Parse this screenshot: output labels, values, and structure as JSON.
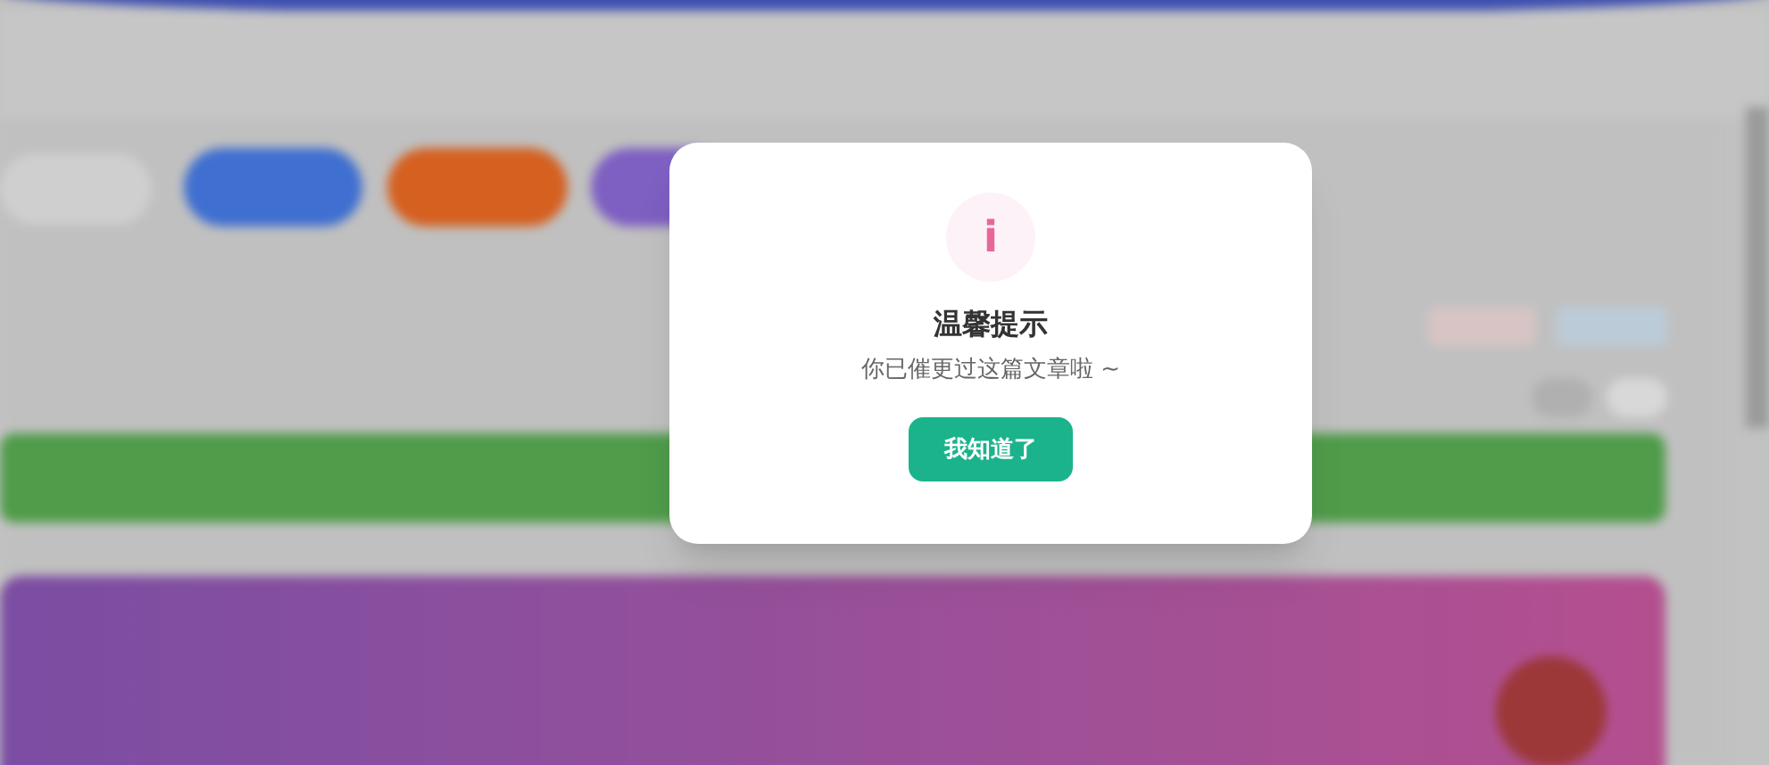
{
  "dialog": {
    "icon_glyph": "i",
    "title": "温馨提示",
    "message": "你已催更过这篇文章啦 ~",
    "button": "我知道了"
  }
}
